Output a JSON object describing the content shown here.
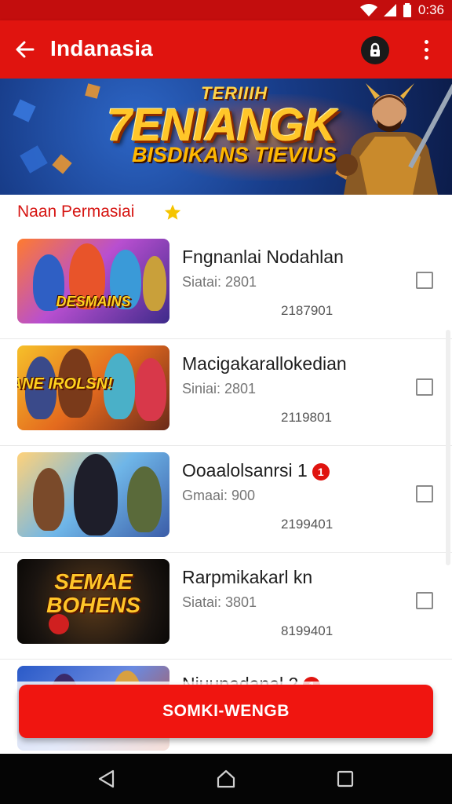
{
  "status_bar": {
    "time": "0:36"
  },
  "app_bar": {
    "title": "Indanasia"
  },
  "banner": {
    "top_text": "TERIIIH",
    "main_text": "7ENIANGK",
    "sub_text": "BISDIKANS TIEVIUS"
  },
  "section": {
    "title": "Naan Permasiai"
  },
  "items": [
    {
      "title": "Fngnanlai Nodahlan",
      "subtitle": "Siatai: 2801",
      "number": "2187901",
      "thumb_text": "DESMAINS",
      "badge": ""
    },
    {
      "title": "Macigakarallokedian",
      "subtitle": "Siniai: 2801",
      "number": "2119801",
      "thumb_text": "BBNANE IROLSN!",
      "badge": ""
    },
    {
      "title": "Ooaalolsanrsi 1",
      "subtitle": "Gmaai: 900",
      "number": "2199401",
      "thumb_text": "",
      "badge": "1"
    },
    {
      "title": "Rarpmikakarl kn",
      "subtitle": "Siatai: 3801",
      "number": "8199401",
      "thumb_text": "SEMAE BOHENS",
      "badge": ""
    },
    {
      "title": "Niuupadanal 2",
      "subtitle": "",
      "number": "",
      "thumb_text": "",
      "badge": "1"
    }
  ],
  "cta": {
    "label": "SOMKI-WENGB"
  },
  "colors": {
    "primary": "#e0140f",
    "status": "#c30d0d",
    "accent_star": "#f5c400"
  },
  "icons": [
    "back-arrow-icon",
    "lock-icon",
    "more-vert-icon",
    "star-icon",
    "checkbox-icon",
    "nav-back-icon",
    "nav-home-icon",
    "nav-recents-icon",
    "wifi-icon",
    "signal-icon",
    "battery-icon"
  ]
}
